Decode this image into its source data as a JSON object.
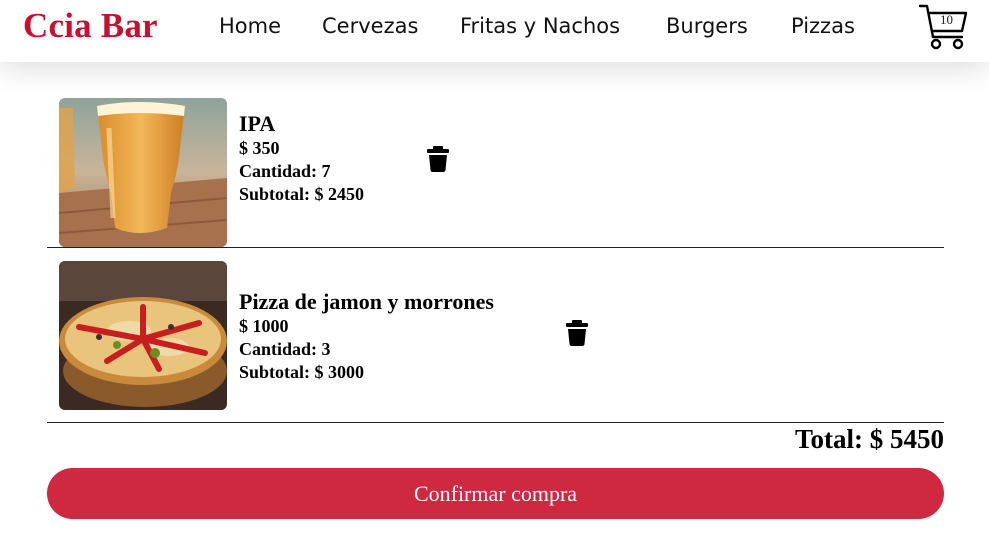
{
  "navbar": {
    "brand": "Ccia Bar",
    "links": [
      {
        "label": "Home"
      },
      {
        "label": "Cervezas"
      },
      {
        "label": "Fritas y Nachos"
      },
      {
        "label": "Burgers"
      },
      {
        "label": "Pizzas"
      }
    ],
    "cart_icon": "cart-icon",
    "cart_count": "10"
  },
  "cart": {
    "items": [
      {
        "name": "IPA",
        "price": "$ 350",
        "quantity": "Cantidad: 7",
        "subtotal": "Subtotal: $ 2450",
        "image": "beer-glass-photo",
        "delete_icon": "trash-icon"
      },
      {
        "name": "Pizza de jamon y morrones",
        "price": "$ 1000",
        "quantity": "Cantidad: 3",
        "subtotal": "Subtotal: $ 3000",
        "image": "pizza-photo",
        "delete_icon": "trash-icon"
      }
    ],
    "total": "Total: $ 5450",
    "confirm_label": "Confirmar compra"
  },
  "colors": {
    "brand": "#c8102e",
    "confirm_button": "#cf2841",
    "confirm_text": "#ffffff"
  }
}
